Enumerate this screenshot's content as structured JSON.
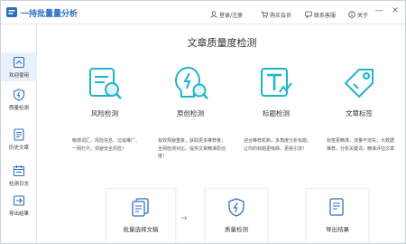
{
  "window": {
    "title": "一持批量量分析",
    "login": "登录/注册",
    "buy": "购买会员",
    "contact": "联系客服",
    "about": "关于",
    "minimize": "—",
    "close": "✕"
  },
  "sidebar": {
    "items": [
      {
        "label": "欢迎使用",
        "icon": "home-icon"
      },
      {
        "label": "质量检测",
        "icon": "shield-icon"
      },
      {
        "label": "历史文章",
        "icon": "document-icon"
      },
      {
        "label": "检测日志",
        "icon": "calendar-icon"
      },
      {
        "label": "导出结果",
        "icon": "export-icon"
      }
    ]
  },
  "main": {
    "title": "文章质量度检测",
    "features": [
      {
        "name": "风险检测",
        "icon": "risk-check-icon",
        "desc": "敏感词汇、风险信息、垃圾推广、一网打尽，规避安全风险！"
      },
      {
        "name": "原创检测",
        "icon": "original-check-icon",
        "desc": "有效规避重复，获取更多推荐量；全网检测对比，提供文章精准原创度！"
      },
      {
        "name": "标题检测",
        "icon": "title-check-icon",
        "desc": "迎合推荐机制，多角度分析标题，让你的标题更吸睛，更易引流！"
      },
      {
        "name": "文章标签",
        "icon": "tag-icon",
        "desc": "标签更精准，流量不流失；大数据推荐，分析关键词，精准评估文章"
      }
    ],
    "steps": [
      {
        "label": "批量选择文稿",
        "icon": "batch-docs-icon"
      },
      {
        "label": "质量检测",
        "icon": "quality-check-icon"
      },
      {
        "label": "导出结果",
        "icon": "export-result-icon"
      }
    ],
    "arrow": "→"
  },
  "colors": {
    "accent": "#1fb5c9",
    "brand": "#2f6fc0",
    "active_bg": "#e9f2fb"
  }
}
